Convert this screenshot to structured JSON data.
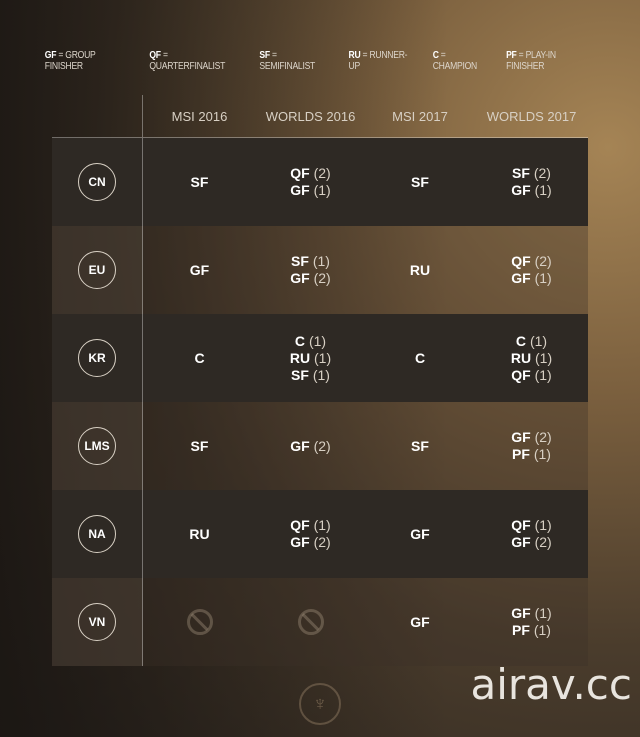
{
  "legend": [
    {
      "abbr": "GF",
      "text": "= GROUP FINISHER"
    },
    {
      "abbr": "QF",
      "text": "= QUARTERFINALIST"
    },
    {
      "abbr": "SF",
      "text": "= SEMIFINALIST"
    },
    {
      "abbr": "RU",
      "text": "= RUNNER-UP"
    },
    {
      "abbr": "C",
      "text": "= CHAMPION"
    },
    {
      "abbr": "PF",
      "text": "= PLAY-IN FINISHER"
    }
  ],
  "columns": [
    "MSI 2016",
    "WORLDS 2016",
    "MSI 2017",
    "WORLDS 2017"
  ],
  "rows": [
    {
      "region": "CN",
      "cells": [
        [
          [
            "SF",
            ""
          ]
        ],
        [
          [
            "QF",
            "(2)"
          ],
          [
            "GF",
            "(1)"
          ]
        ],
        [
          [
            "SF",
            ""
          ]
        ],
        [
          [
            "SF",
            "(2)"
          ],
          [
            "GF",
            "(1)"
          ]
        ]
      ]
    },
    {
      "region": "EU",
      "cells": [
        [
          [
            "GF",
            ""
          ]
        ],
        [
          [
            "SF",
            "(1)"
          ],
          [
            "GF",
            "(2)"
          ]
        ],
        [
          [
            "RU",
            ""
          ]
        ],
        [
          [
            "QF",
            "(2)"
          ],
          [
            "GF",
            "(1)"
          ]
        ]
      ]
    },
    {
      "region": "KR",
      "cells": [
        [
          [
            "C",
            ""
          ]
        ],
        [
          [
            "C",
            "(1)"
          ],
          [
            "RU",
            "(1)"
          ],
          [
            "SF",
            "(1)"
          ]
        ],
        [
          [
            "C",
            ""
          ]
        ],
        [
          [
            "C",
            "(1)"
          ],
          [
            "RU",
            "(1)"
          ],
          [
            "QF",
            "(1)"
          ]
        ]
      ]
    },
    {
      "region": "LMS",
      "cells": [
        [
          [
            "SF",
            ""
          ]
        ],
        [
          [
            "GF",
            "(2)"
          ]
        ],
        [
          [
            "SF",
            ""
          ]
        ],
        [
          [
            "GF",
            "(2)"
          ],
          [
            "PF",
            "(1)"
          ]
        ]
      ]
    },
    {
      "region": "NA",
      "cells": [
        [
          [
            "RU",
            ""
          ]
        ],
        [
          [
            "QF",
            "(1)"
          ],
          [
            "GF",
            "(2)"
          ]
        ],
        [
          [
            "GF",
            ""
          ]
        ],
        [
          [
            "QF",
            "(1)"
          ],
          [
            "GF",
            "(2)"
          ]
        ]
      ]
    },
    {
      "region": "VN",
      "cells": [
        "not-participated-icon",
        "not-participated-icon",
        [
          [
            "GF",
            ""
          ]
        ],
        [
          [
            "GF",
            "(1)"
          ],
          [
            "PF",
            "(1)"
          ]
        ]
      ]
    }
  ],
  "watermark": "airav.cc"
}
